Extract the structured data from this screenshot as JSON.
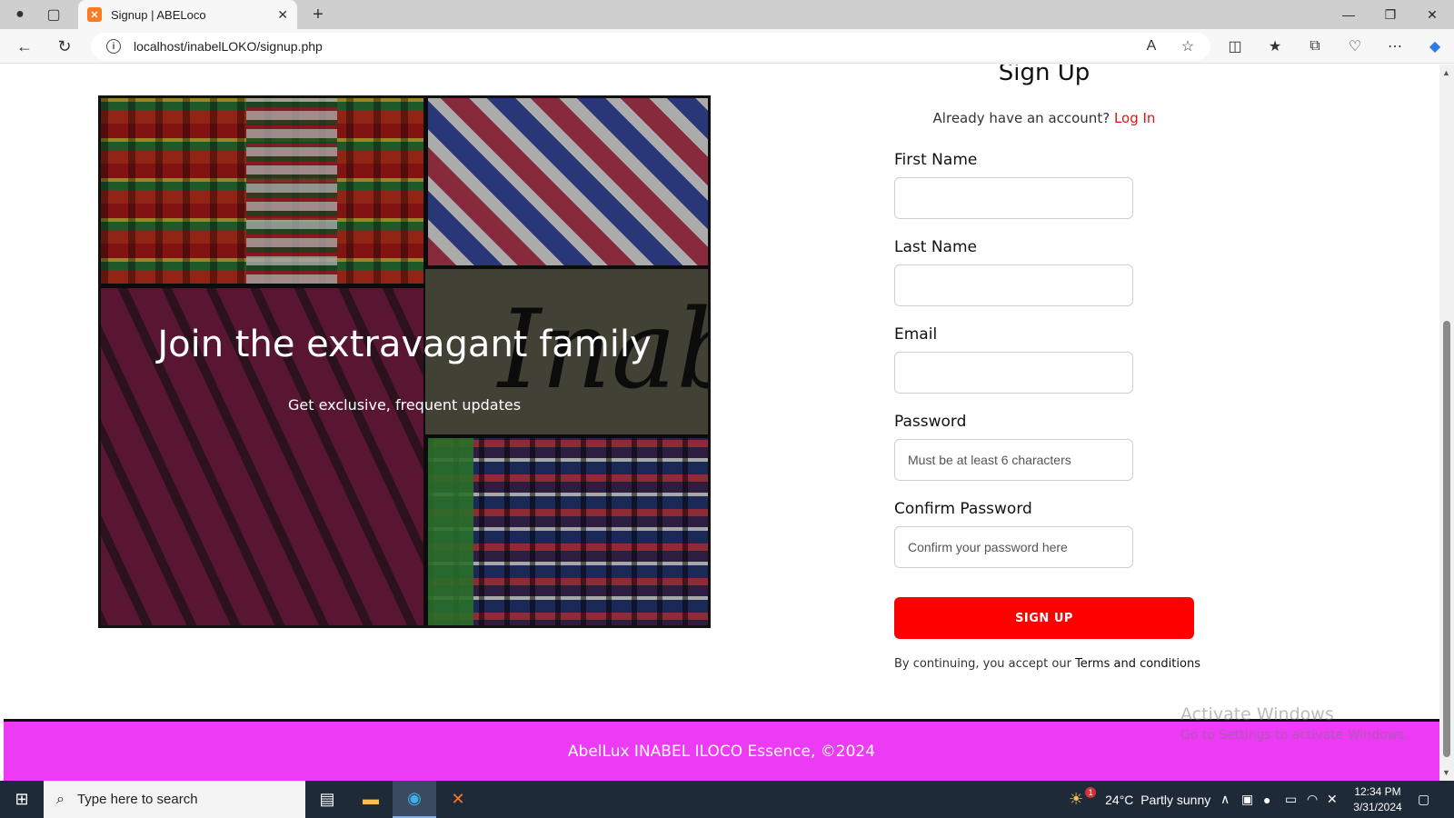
{
  "browser": {
    "tab_title": "Signup | ABELoco",
    "url": "localhost/inabelLOKO/signup.php"
  },
  "hero": {
    "title": "Join the extravagant family",
    "subtitle": "Get exclusive, frequent updates",
    "image_text": "Inabe"
  },
  "form": {
    "title": "Sign Up",
    "login_prompt": "Already have an account?",
    "login_link": "Log In",
    "fields": [
      {
        "label": "First Name",
        "value": "",
        "placeholder": ""
      },
      {
        "label": "Last Name",
        "value": "",
        "placeholder": ""
      },
      {
        "label": "Email",
        "value": "",
        "placeholder": ""
      },
      {
        "label": "Password",
        "value": "",
        "placeholder": "Must be at least 6 characters"
      },
      {
        "label": "Confirm Password",
        "value": "",
        "placeholder": "Confirm your password here"
      }
    ],
    "submit_label": "SIGN UP",
    "terms_prefix": "By continuing, you accept our",
    "terms_link": "Terms and conditions"
  },
  "footer": {
    "text": "AbelLux INABEL ILOCO Essence, ©2024"
  },
  "watermark": {
    "line1": "Activate Windows",
    "line2": "Go to Settings to activate Windows."
  },
  "taskbar": {
    "search_placeholder": "Type here to search",
    "weather_temp": "24°C",
    "weather_desc": "Partly sunny",
    "weather_badge": "1",
    "time": "12:34 PM",
    "date": "3/31/2024"
  },
  "colors": {
    "accent_red": "#ff0000",
    "footer_magenta": "#ec3af5",
    "link_red": "#e01414"
  }
}
